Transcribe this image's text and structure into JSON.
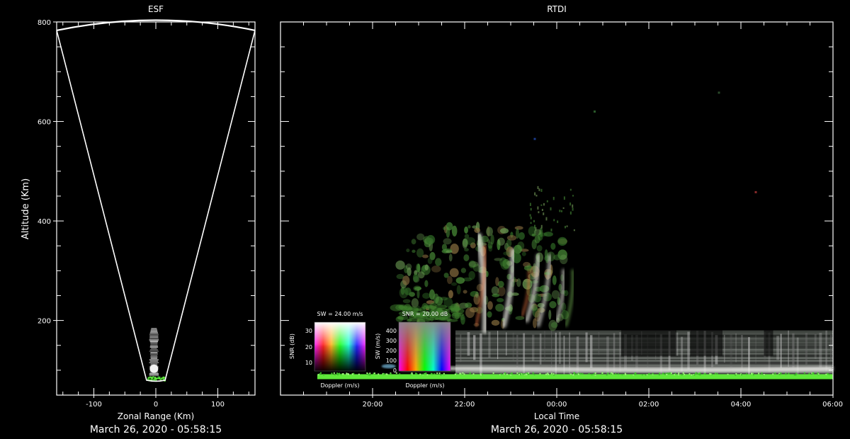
{
  "chart_data": [
    {
      "type": "scatter",
      "title": "ESF",
      "xlabel": "Zonal Range (Km)",
      "ylabel": "Altitude (Km)",
      "xlim": [
        -160,
        160
      ],
      "ylim": [
        50,
        800
      ],
      "x_ticks": [
        -100,
        0,
        100
      ],
      "y_ticks": [
        200,
        400,
        600,
        800
      ],
      "footer": "March 26, 2020 - 05:58:15",
      "beam_cone": {
        "apex_altitude": 80,
        "apex_half_width": 15,
        "outer_altitude": 800,
        "outer_half_width": 160,
        "arc_peak_altitude": 800,
        "arc_edge_altitude": 783
      },
      "echo_column": {
        "x": -3,
        "altitude_range": [
          80,
          185
        ]
      }
    },
    {
      "type": "heatmap",
      "title": "RTDI",
      "xlabel": "Local Time",
      "x_ticks": [
        "20:00",
        "22:00",
        "00:00",
        "02:00",
        "04:00",
        "06:00"
      ],
      "x_tick_hours": [
        20,
        22,
        24,
        26,
        28,
        30
      ],
      "xlim_hours": [
        18.0,
        30.0
      ],
      "ylim": [
        50,
        800
      ],
      "footer": "March 26, 2020 - 05:58:15",
      "echo_regions": [
        {
          "name": "plume",
          "t_range": [
            22.3,
            23.3
          ],
          "altitude_range": [
            180,
            350
          ]
        },
        {
          "name": "bottomside-layer",
          "t_range": [
            20.5,
            30.0
          ],
          "altitude_range": [
            90,
            180
          ]
        },
        {
          "name": "base-band",
          "t_range": [
            18.8,
            30.0
          ],
          "altitude_range": [
            82,
            92
          ]
        }
      ],
      "legends": [
        {
          "title": "SW = 24.00 m/s",
          "xlabel": "Doppler (m/s)",
          "ylabel": "SNR (dB)",
          "y_ticks": [
            "30",
            "20",
            "10"
          ]
        },
        {
          "title": "SNR = 20.00 dB",
          "xlabel": "Doppler (m/s)",
          "ylabel": "SW (m/s)",
          "y_ticks": [
            "400",
            "300",
            "200",
            "100",
            "0"
          ]
        }
      ]
    }
  ],
  "colors": {
    "background": "#000000",
    "axes": "#ffffff",
    "base_band": "#5fe83a",
    "plume_green": "#3b7a2a",
    "plume_white": "#d8d8d0"
  }
}
